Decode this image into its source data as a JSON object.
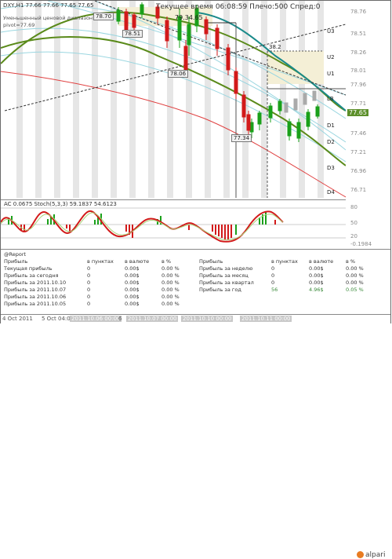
{
  "window": {
    "title": "DXY,H1 77.66 77.66 77.65 77.65",
    "subtitle": "Уменьшенный ценовой диапазон",
    "pivot": "pivot=77.69",
    "info": "Текущее время 06:08:59 Плечо:500 Спред:0"
  },
  "price_axis": [
    "78.76",
    "78.51",
    "78.26",
    "78.01",
    "77.96",
    "77.71",
    "77.65",
    "77.46",
    "77.21",
    "76.96",
    "76.71"
  ],
  "current_price": "77.65",
  "levels": {
    "u3": "U3",
    "u2": "U2",
    "u1": "U1",
    "lb": "LB",
    "d1": "D1",
    "d2": "D2",
    "d3": "D3",
    "d4": "D4"
  },
  "price_tags": {
    "p1": "78.70",
    "p2": "78.51",
    "p3": "78.06",
    "p4": "77.34",
    "p5": "38.2",
    "p6": "78.58",
    "p7": "79.34.65"
  },
  "indicator": {
    "title": "AC 0.0675  Stoch(5,3,3) 59.1837 54.6123",
    "axis": [
      "80",
      "50",
      "20",
      "-0.1984"
    ]
  },
  "report": {
    "header": "@Report",
    "left_cols": [
      "Прибыль",
      "в пунктах",
      "в валюте",
      "в %"
    ],
    "left_rows": [
      [
        "Текущая прибыль",
        "0",
        "0.00$",
        "0.00 %"
      ],
      [
        "Прибыль за сегодня",
        "0",
        "0.00$",
        "0.00 %"
      ],
      [
        "Прибыль за 2011.10.10",
        "0",
        "0.00$",
        "0.00 %"
      ],
      [
        "Прибыль за 2011.10.07",
        "0",
        "0.00$",
        "0.00 %"
      ],
      [
        "Прибыль за 2011.10.06",
        "0",
        "0.00$",
        "0.00 %"
      ],
      [
        "Прибыль за 2011.10.05",
        "0",
        "0.00$",
        "0.00 %"
      ]
    ],
    "right_cols": [
      "Прибыль",
      "в пунктах",
      "в валюте",
      "в %"
    ],
    "right_rows": [
      [
        "Прибыль за неделю",
        "0",
        "0.00$",
        "0.00 %"
      ],
      [
        "Прибыль за месяц",
        "0",
        "0.00$",
        "0.00 %"
      ],
      [
        "Прибыль за квартал",
        "0",
        "0.00$",
        "0.00 %"
      ],
      [
        "Прибыль за год",
        "56",
        "4.96$",
        "0.05 %"
      ]
    ]
  },
  "time_axis": [
    "4 Oct 2011",
    "5 Oct 04:00",
    "2011.10.06 00:00",
    "6",
    "2011.10.07 00:00",
    "2011.10.10 00:00",
    "2011.10.11 00:00"
  ],
  "brand": "alpari",
  "colors": {
    "up": "#1aa01a",
    "down": "#d21a1a",
    "ma": "#5a8a1a",
    "teal": "#1a8a8a",
    "red_line": "#e04040"
  }
}
